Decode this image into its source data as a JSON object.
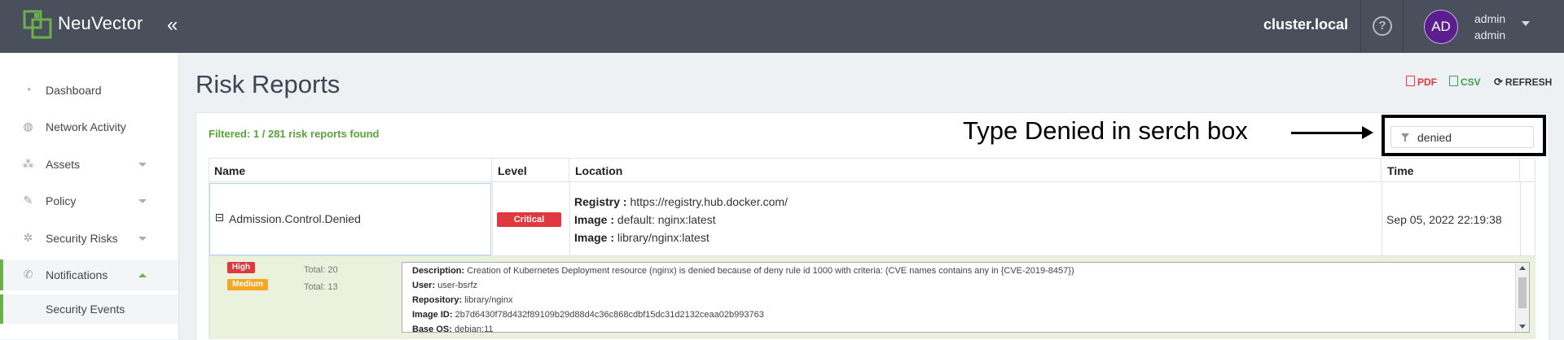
{
  "header": {
    "brand": "NeuVector",
    "cluster": "cluster.local",
    "help_glyph": "?",
    "avatar_initials": "AD",
    "user_name": "admin",
    "user_role": "admin",
    "colors": {
      "bar": "#4a4f5c",
      "logo": "#6ab04c",
      "avatar": "#5b1e8e"
    }
  },
  "sidebar": {
    "items": [
      {
        "label": "Dashboard",
        "icon": "dashboard-gauge-icon"
      },
      {
        "label": "Network Activity",
        "icon": "globe-icon"
      },
      {
        "label": "Assets",
        "icon": "assets-cubes-icon"
      },
      {
        "label": "Policy",
        "icon": "gavel-icon"
      },
      {
        "label": "Security Risks",
        "icon": "bug-icon"
      },
      {
        "label": "Notifications",
        "icon": "notification-phone-icon"
      }
    ],
    "subitems": [
      {
        "label": "Security Events"
      }
    ]
  },
  "page": {
    "title": "Risk Reports",
    "pdf_label": "PDF",
    "csv_label": "CSV",
    "refresh_label": "REFRESH",
    "filtered_text": "Filtered: 1 / 281 risk reports found",
    "annotation": "Type Denied in serch box",
    "search_value": "denied"
  },
  "table": {
    "headers": [
      "Name",
      "Level",
      "Location",
      "Time"
    ],
    "row": {
      "name": "Admission.Control.Denied",
      "level": "Critical",
      "location": [
        {
          "key": "Registry :",
          "value": "https://registry.hub.docker.com/"
        },
        {
          "key": "Image :",
          "value": "default: nginx:latest"
        },
        {
          "key": "Image :",
          "value": "library/nginx:latest"
        }
      ],
      "time": "Sep 05, 2022 22:19:38"
    },
    "expanded": {
      "severities": [
        {
          "label": "High",
          "total": "Total: 20",
          "color": "#e0383e"
        },
        {
          "label": "Medium",
          "total": "Total: 13",
          "color": "#f5a623"
        }
      ],
      "details": [
        {
          "key": "Description:",
          "value": "Creation of Kubernetes Deployment resource (nginx) is denied because of deny rule id 1000 with criteria: (CVE names contains any in {CVE-2019-8457})"
        },
        {
          "key": "User:",
          "value": "user-bsrfz"
        },
        {
          "key": "Repository:",
          "value": "library/nginx"
        },
        {
          "key": "Image ID:",
          "value": "2b7d6430f78d432f89109b29d88d4c36c868cdbf15dc31d2132ceaa02b993763"
        },
        {
          "key": "Base OS:",
          "value": "debian:11"
        }
      ]
    }
  }
}
